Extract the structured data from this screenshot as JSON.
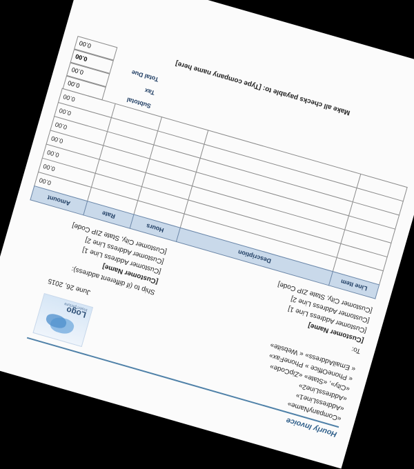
{
  "document": {
    "title": "Hourly Invoice",
    "logo": {
      "word": "Logo",
      "tagline": "Insert picture"
    },
    "sender_fields": [
      "«CompanyName»",
      "«AddressLine1»",
      "«AddressLine2»",
      "«City», «State» «ZipCode»",
      "« PhoneOffice » PhoneFax»",
      "« EmailAddress» « Website»"
    ],
    "date": "June 26, 2015",
    "to_label": "To:",
    "bill_to": [
      "[Customer Name]",
      "[Customer Address Line 1]",
      "[Customer Address Line 2]",
      "[Customer City, State ZIP Code]"
    ],
    "ship_to_label": "Ship to (if different address):",
    "ship_to": [
      "[Customer Name]",
      "[Customer Address Line 1]",
      "[Customer Address Line 2]",
      "[Customer City, State ZIP Code]"
    ],
    "table": {
      "headers": [
        "Line Item",
        "Description",
        "Hours",
        "Rate",
        "Amount"
      ],
      "amounts": [
        "0.00",
        "0.00",
        "0.00",
        "0.00",
        "0.00",
        "0.00",
        "0.00"
      ]
    },
    "totals": {
      "subtotal_label": "Subtotal",
      "subtotal": "0.00",
      "tax_label": "Tax",
      "tax": "0.00",
      "total_label": "Total Due",
      "total": "0.00",
      "extra": "0.00"
    },
    "payable_line": "Make all checks payable to: [Type company name here]"
  }
}
